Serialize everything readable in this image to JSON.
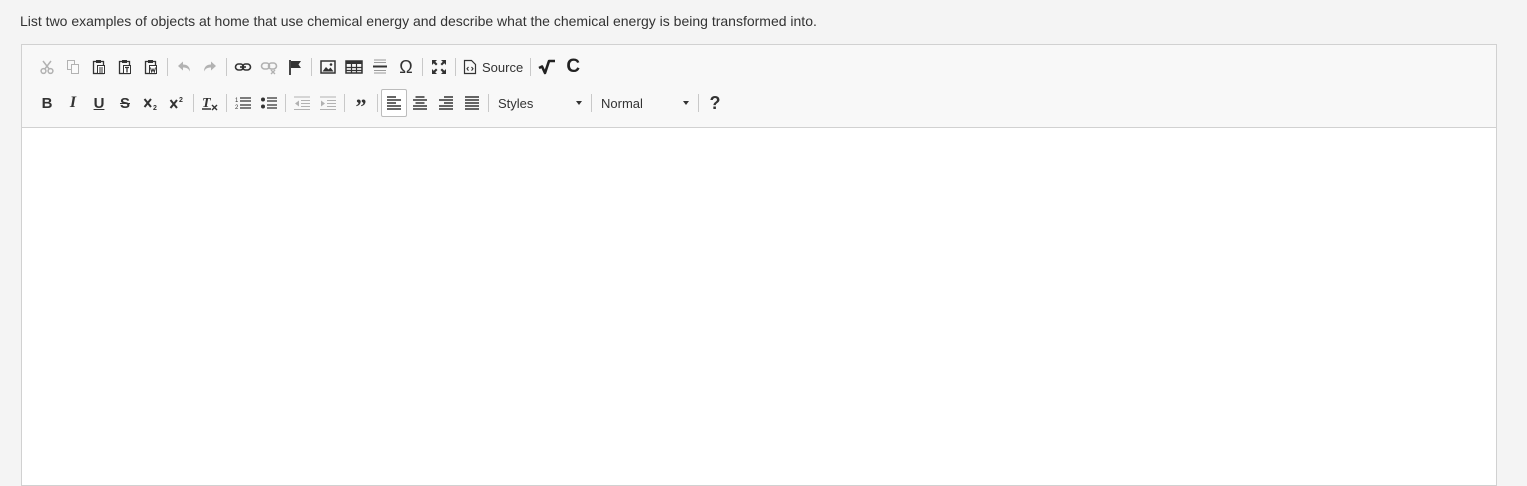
{
  "question": "List two examples of objects at home that use chemical energy and describe what the chemical energy is being transformed into.",
  "toolbar": {
    "source_label": "Source",
    "styles_label": "Styles",
    "format_label": "Normal",
    "help_label": "?"
  },
  "editor": {
    "content": ""
  }
}
